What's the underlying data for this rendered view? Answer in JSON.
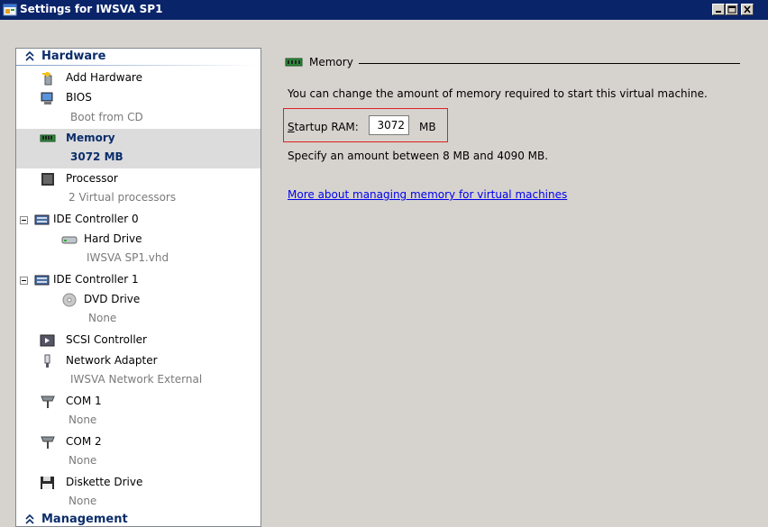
{
  "window": {
    "title": "Settings for IWSVA SP1"
  },
  "tree": {
    "hardware_header": "Hardware",
    "management_header": "Management",
    "add_hardware": "Add Hardware",
    "bios": {
      "label": "BIOS",
      "sub": "Boot from CD"
    },
    "memory": {
      "label": "Memory",
      "sub": "3072 MB"
    },
    "processor": {
      "label": "Processor",
      "sub": "2 Virtual processors"
    },
    "ide0": {
      "label": "IDE Controller 0"
    },
    "hard_drive": {
      "label": "Hard Drive",
      "sub": "IWSVA SP1.vhd"
    },
    "ide1": {
      "label": "IDE Controller 1"
    },
    "dvd_drive": {
      "label": "DVD Drive",
      "sub": "None"
    },
    "scsi": {
      "label": "SCSI Controller"
    },
    "network": {
      "label": "Network Adapter",
      "sub": "IWSVA Network External"
    },
    "com1": {
      "label": "COM 1",
      "sub": "None"
    },
    "com2": {
      "label": "COM 2",
      "sub": "None"
    },
    "diskette": {
      "label": "Diskette Drive",
      "sub": "None"
    }
  },
  "detail": {
    "group_title": "Memory",
    "description": "You can change the amount of memory required to start this virtual machine.",
    "startup_ram_label_first": "S",
    "startup_ram_label_rest": "tartup RAM:",
    "startup_ram_value": "3072",
    "startup_ram_unit": "MB",
    "range_text": "Specify an amount between 8 MB and 4090 MB.",
    "more_link": "More about managing memory for virtual machines"
  },
  "colors": {
    "titlebar": "#0a246a",
    "panel_bg": "#d6d3ce",
    "selection_bg": "#dcdcdc",
    "header_text": "#0b2d6b",
    "highlight_border": "#e02020",
    "link": "#0000ee"
  }
}
